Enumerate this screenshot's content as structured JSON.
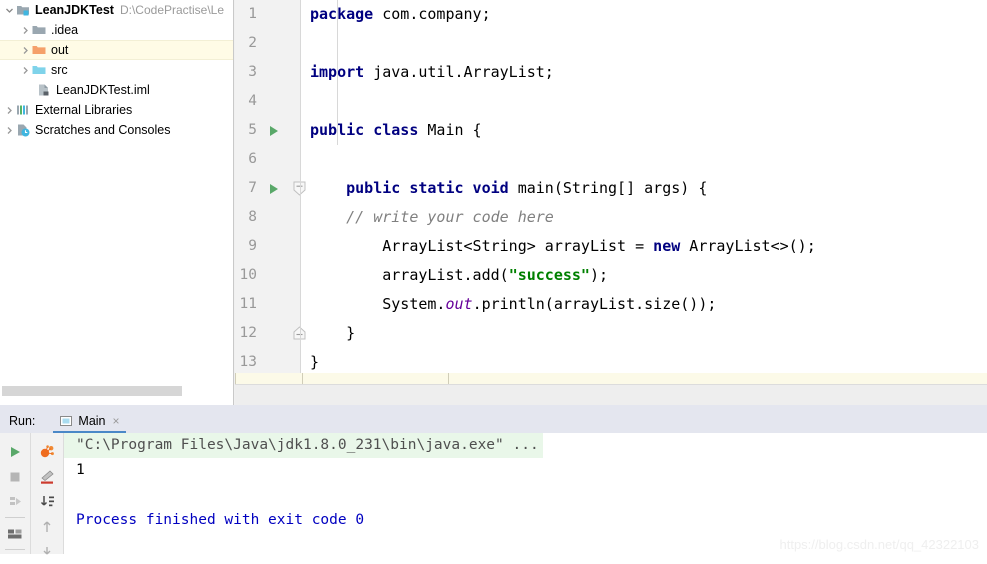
{
  "project_panel": {
    "tree": [
      {
        "label": "LeanJDKTest",
        "path": "D:\\CodePractise\\Le",
        "icon": "project-module-icon",
        "indent": 0,
        "expanded": true,
        "bold": true,
        "selected": false
      },
      {
        "label": ".idea",
        "icon": "folder-gray-icon",
        "indent": 1,
        "expanded": false,
        "bold": false,
        "selected": false
      },
      {
        "label": "out",
        "icon": "folder-orange-icon",
        "indent": 1,
        "expanded": false,
        "bold": false,
        "selected": true
      },
      {
        "label": "src",
        "icon": "folder-blue-icon",
        "indent": 1,
        "expanded": false,
        "bold": false,
        "selected": false
      },
      {
        "label": "LeanJDKTest.iml",
        "icon": "iml-file-icon",
        "indent": 2,
        "expanded": null,
        "bold": false,
        "selected": false
      },
      {
        "label": "External Libraries",
        "icon": "libraries-icon",
        "indent": 0,
        "expanded": false,
        "bold": false,
        "selected": false
      },
      {
        "label": "Scratches and Consoles",
        "icon": "scratches-icon",
        "indent": 0,
        "expanded": false,
        "bold": false,
        "selected": false
      }
    ]
  },
  "editor": {
    "line_numbers": [
      "1",
      "2",
      "3",
      "4",
      "5",
      "6",
      "7",
      "8",
      "9",
      "10",
      "11",
      "12",
      "13"
    ],
    "run_marker_lines": [
      5,
      7
    ],
    "fold_marker_lines": [
      7,
      12
    ],
    "lines": [
      {
        "n": 1,
        "tokens": [
          {
            "t": "kw",
            "v": "package"
          },
          {
            "t": "plain",
            "v": " com.company;"
          }
        ]
      },
      {
        "n": 2,
        "tokens": []
      },
      {
        "n": 3,
        "tokens": [
          {
            "t": "kw",
            "v": "import"
          },
          {
            "t": "plain",
            "v": " java.util.ArrayList;"
          }
        ]
      },
      {
        "n": 4,
        "tokens": []
      },
      {
        "n": 5,
        "tokens": [
          {
            "t": "kw",
            "v": "public class"
          },
          {
            "t": "plain",
            "v": " Main {"
          }
        ]
      },
      {
        "n": 6,
        "tokens": []
      },
      {
        "n": 7,
        "tokens": [
          {
            "t": "plain",
            "v": "    "
          },
          {
            "t": "kw",
            "v": "public static void"
          },
          {
            "t": "plain",
            "v": " main(String[] args) {"
          }
        ]
      },
      {
        "n": 8,
        "tokens": [
          {
            "t": "cmt",
            "v": "    // write your code here"
          }
        ]
      },
      {
        "n": 9,
        "tokens": [
          {
            "t": "plain",
            "v": "        ArrayList<String> arrayList = "
          },
          {
            "t": "kw",
            "v": "new"
          },
          {
            "t": "plain",
            "v": " ArrayList<>();"
          }
        ]
      },
      {
        "n": 10,
        "tokens": [
          {
            "t": "plain",
            "v": "        arrayList.add("
          },
          {
            "t": "str",
            "v": "\"success\""
          },
          {
            "t": "plain",
            "v": ");"
          }
        ]
      },
      {
        "n": 11,
        "tokens": [
          {
            "t": "plain",
            "v": "        System."
          },
          {
            "t": "fld",
            "v": "out"
          },
          {
            "t": "plain",
            "v": ".println(arrayList.size());"
          }
        ]
      },
      {
        "n": 12,
        "tokens": [
          {
            "t": "plain",
            "v": "    }"
          }
        ]
      },
      {
        "n": 13,
        "tokens": [
          {
            "t": "plain",
            "v": "}"
          }
        ]
      }
    ]
  },
  "run_panel": {
    "title": "Run:",
    "tab_label": "Main",
    "tab_close": "×",
    "toolbar_left": [
      {
        "name": "rerun-button",
        "icon": "green-play-icon"
      },
      {
        "name": "stop-button",
        "icon": "gray-stop-square-icon"
      },
      {
        "name": "resume-program-button",
        "icon": "resume-icon"
      },
      {
        "name": "layout-button",
        "icon": "layout-icon"
      }
    ],
    "toolbar_right": [
      {
        "name": "toggle-coverage-button",
        "icon": "coverage-icon"
      },
      {
        "name": "soft-wrap-button",
        "icon": "pencil-underline-icon"
      },
      {
        "name": "scroll-to-end-button",
        "icon": "scroll-down-icon"
      },
      {
        "name": "up-the-stack-trace-button",
        "icon": "arrow-up-icon"
      },
      {
        "name": "down-the-stack-trace-button",
        "icon": "arrow-down-icon"
      }
    ],
    "console": {
      "command_line": "\"C:\\Program Files\\Java\\jdk1.8.0_231\\bin\\java.exe\" ...",
      "output": "1",
      "blank": "",
      "exit_line": "Process finished with exit code 0"
    }
  },
  "watermark": "https://blog.csdn.net/qq_42322103",
  "colors": {
    "keyword": "#000080",
    "string": "#008000",
    "comment": "#808080",
    "static_field": "#660099",
    "selection_row": "#fffbe6",
    "run_green": "#59a869",
    "tab_underline": "#4a88c7",
    "console_cmd_bg": "#e9f7e9",
    "exit_code_blue": "#0000c0",
    "gutter_bg": "#f2f2f2",
    "panel_bg": "#e4e6ef"
  }
}
